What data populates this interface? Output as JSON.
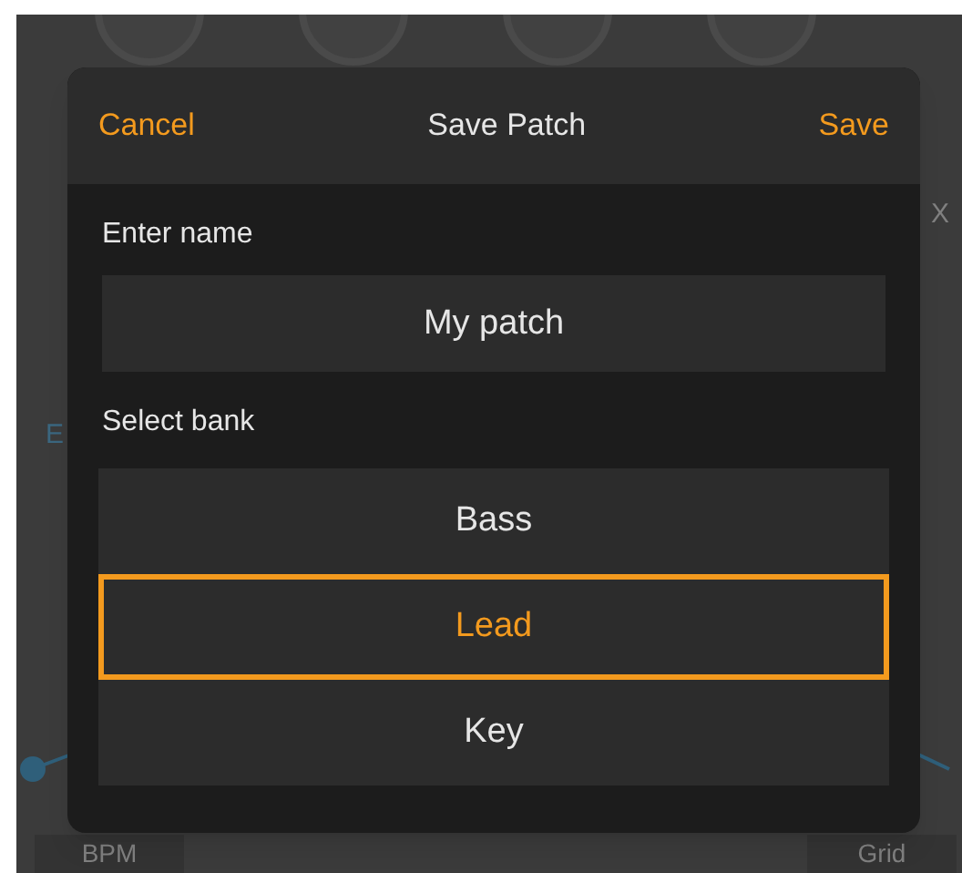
{
  "background": {
    "left_label": "E",
    "right_label": "X",
    "bottom_left": "BPM",
    "bottom_right": "Grid"
  },
  "dialog": {
    "cancel": "Cancel",
    "title": "Save Patch",
    "save": "Save",
    "name_label": "Enter name",
    "name_value": "My patch",
    "bank_label": "Select bank",
    "banks": [
      {
        "label": "Bass",
        "selected": false
      },
      {
        "label": "Lead",
        "selected": true
      },
      {
        "label": "Key",
        "selected": false
      }
    ]
  }
}
